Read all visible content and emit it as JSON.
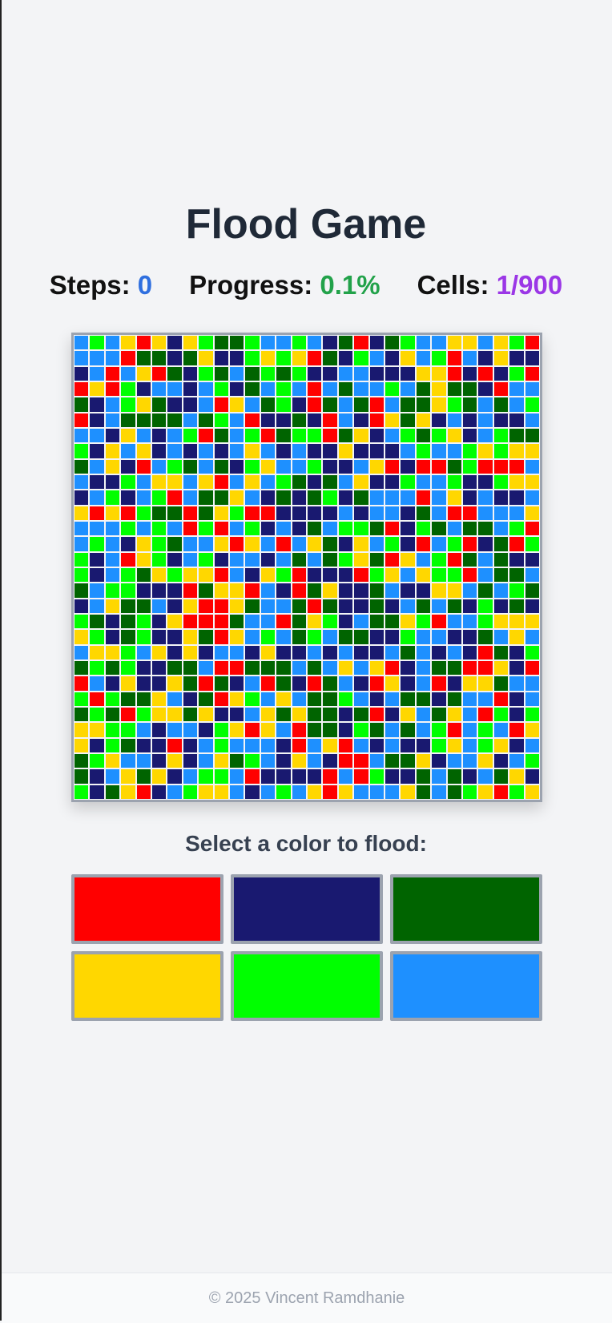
{
  "title": "Flood Game",
  "stats": {
    "steps_label": "Steps:",
    "steps_value": "0",
    "progress_label": "Progress:",
    "progress_value": "0.1%",
    "cells_label": "Cells:",
    "cells_value": "1/900"
  },
  "prompt": "Select a color to flood:",
  "palette": [
    {
      "name": "red",
      "color": "#ff0000"
    },
    {
      "name": "navy",
      "color": "#191970"
    },
    {
      "name": "darkgreen",
      "color": "#006400"
    },
    {
      "name": "gold",
      "color": "#ffd700"
    },
    {
      "name": "lime",
      "color": "#00ff00"
    },
    {
      "name": "blue",
      "color": "#1e90ff"
    }
  ],
  "board": {
    "rows": 30,
    "cols": 30,
    "colors": {
      "R": "#ff0000",
      "N": "#191970",
      "D": "#006400",
      "Y": "#ffd700",
      "L": "#00ff00",
      "B": "#1e90ff"
    },
    "grid": [
      "BLBYRYNYLDDLBBLBNDRNDLBBYYBYLR",
      "BBBRDDNDYNNLYLYRDNLBNYBLRBNYNN",
      "NBRBYRDNLDBDLDLNNBBNNNYYRNRNLR",
      "RYRLNBBNBLNDBLBRBDBBLBDYDDNRBB",
      "DNBLYDNNBRYBDLNRDBDRBDDYLDBDBL",
      "RNBDDDDBDLBRNNDNRBNRYDYNBNBNNB",
      "BBNYBNBLRDBLRDLLRDYNBLDLYNBLDD",
      "LNYBYNBNBNBYBNBNNYNNNBLBBLYLYY",
      "DBYNRBLDBDNLYBBLNNBYRNRRDLRRRB",
      "BNNLBYYBYRBYBLDNDBYNNLBBLNNLYY",
      "NBLNBLRBDDYBNDNDLNDBBBRBYNBNNB",
      "YRYRLDDRDYLRRNNNNBNBBNDBRRBBBY",
      "BBBLBLBRLRBLNBNDBLLDRNLDBDDBLR",
      "BLBNYLDBBYRYBRBYDNYBLNRBLRNDRL",
      "LNBRYLNBLNBBNBDBDLYDRYBLRDBDNN",
      "LNBLDYLYYRBNYLRNNNRLYBYLLRBDDB",
      "DBLLNNNRDYYRBNRDYNNDBNNYYBDBLD",
      "NBYDDBNYRRYDBBDRDNNDNBDBDNLNDN",
      "LDNDLNYRRRDBBRDYLNBDDYLRBBLYYY",
      "YLNDLNNYDRYBLBDLBDDNNLBBNNDBYB",
      "BYYLBYNYNBBNYNNBNBNNBDBNBNRDNL",
      "DLDLNNDDBRRDDDBDBYBYRNBDDRRYNR",
      "RBNYNNYDRDNBRDNRDBNRYNBRNYYDBB",
      "LRLDDYBNDRYLBYBDDLBNBDDNDBBRNB",
      "DLDRLYYDYNNBYDYDDNDRNYBDYBRLNL",
      "YYLLBNBBNLYRYBRDDNLDBDBLRBLBRY",
      "YNLDNNRNBLBBBNRBYRBNBNNLYBLYNB",
      "DLYBBNYNBYDLBNYBNRRBDDYNBBYNBL",
      "DNBYDYNBLLBRNNNNRBRLNNDBDNBDYN",
      "LNDYRNBLYYBNBLBYRYBBBYDBDLYRLY"
    ]
  },
  "footer": "© 2025 Vincent Ramdhanie"
}
